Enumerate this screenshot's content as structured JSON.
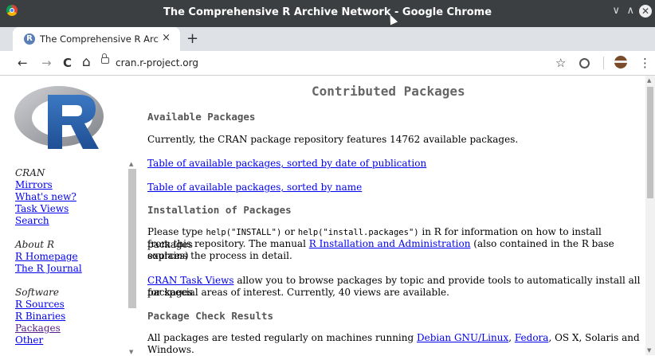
{
  "window": {
    "title": "The Comprehensive R Archive Network - Google Chrome",
    "controls": {
      "minimize": "∨",
      "maximize": "∧",
      "close": "✕"
    }
  },
  "tab": {
    "favicon": "R",
    "label": "The Comprehensive R Archive N",
    "close": "×",
    "new": "+"
  },
  "toolbar": {
    "back": "←",
    "forward": "→",
    "reload": "C",
    "home": "⌂",
    "url": "cran.r-project.org",
    "star": "☆",
    "menu": "⋮"
  },
  "sidebar": {
    "sections": [
      {
        "title": "CRAN",
        "links": [
          "Mirrors",
          "What's new?",
          "Task Views",
          "Search"
        ]
      },
      {
        "title": "About R",
        "links": [
          "R Homepage",
          "The R Journal"
        ]
      },
      {
        "title": "Software",
        "links": [
          "R Sources",
          "R Binaries",
          "Packages",
          "Other"
        ]
      }
    ]
  },
  "main": {
    "title": "Contributed Packages",
    "available_heading": "Available Packages",
    "available_text": "Currently, the CRAN package repository features 14762 available packages.",
    "link_by_date": "Table of available packages, sorted by date of publication",
    "link_by_name": "Table of available packages, sorted by name",
    "install_heading": "Installation of Packages",
    "install_p1": "Please type ",
    "install_code1": "help(\"INSTALL\")",
    "install_p2": " or ",
    "install_code2": "help(\"install.packages\")",
    "install_p3": " in R for information on how to install packages",
    "install_line2a": "from this repository. The manual ",
    "install_link": "R Installation and Administration",
    "install_line2b": " (also contained in the R base sources)",
    "install_line3": "explains the process in detail.",
    "taskviews_link": "CRAN Task Views",
    "taskviews_text": " allow you to browse packages by topic and provide tools to automatically install all packages",
    "taskviews_line2": "for special areas of interest. Currently, 40 views are available.",
    "check_heading": "Package Check Results",
    "check_text_a": "All packages are tested regularly on machines running ",
    "check_link1": "Debian GNU/Linux",
    "check_sep": ", ",
    "check_link2": "Fedora",
    "check_text_b": ", OS X, Solaris and Windows."
  },
  "colors": {
    "titlebar": "#3c3f41",
    "link": "#0000ee",
    "visited": "#551a8b"
  }
}
